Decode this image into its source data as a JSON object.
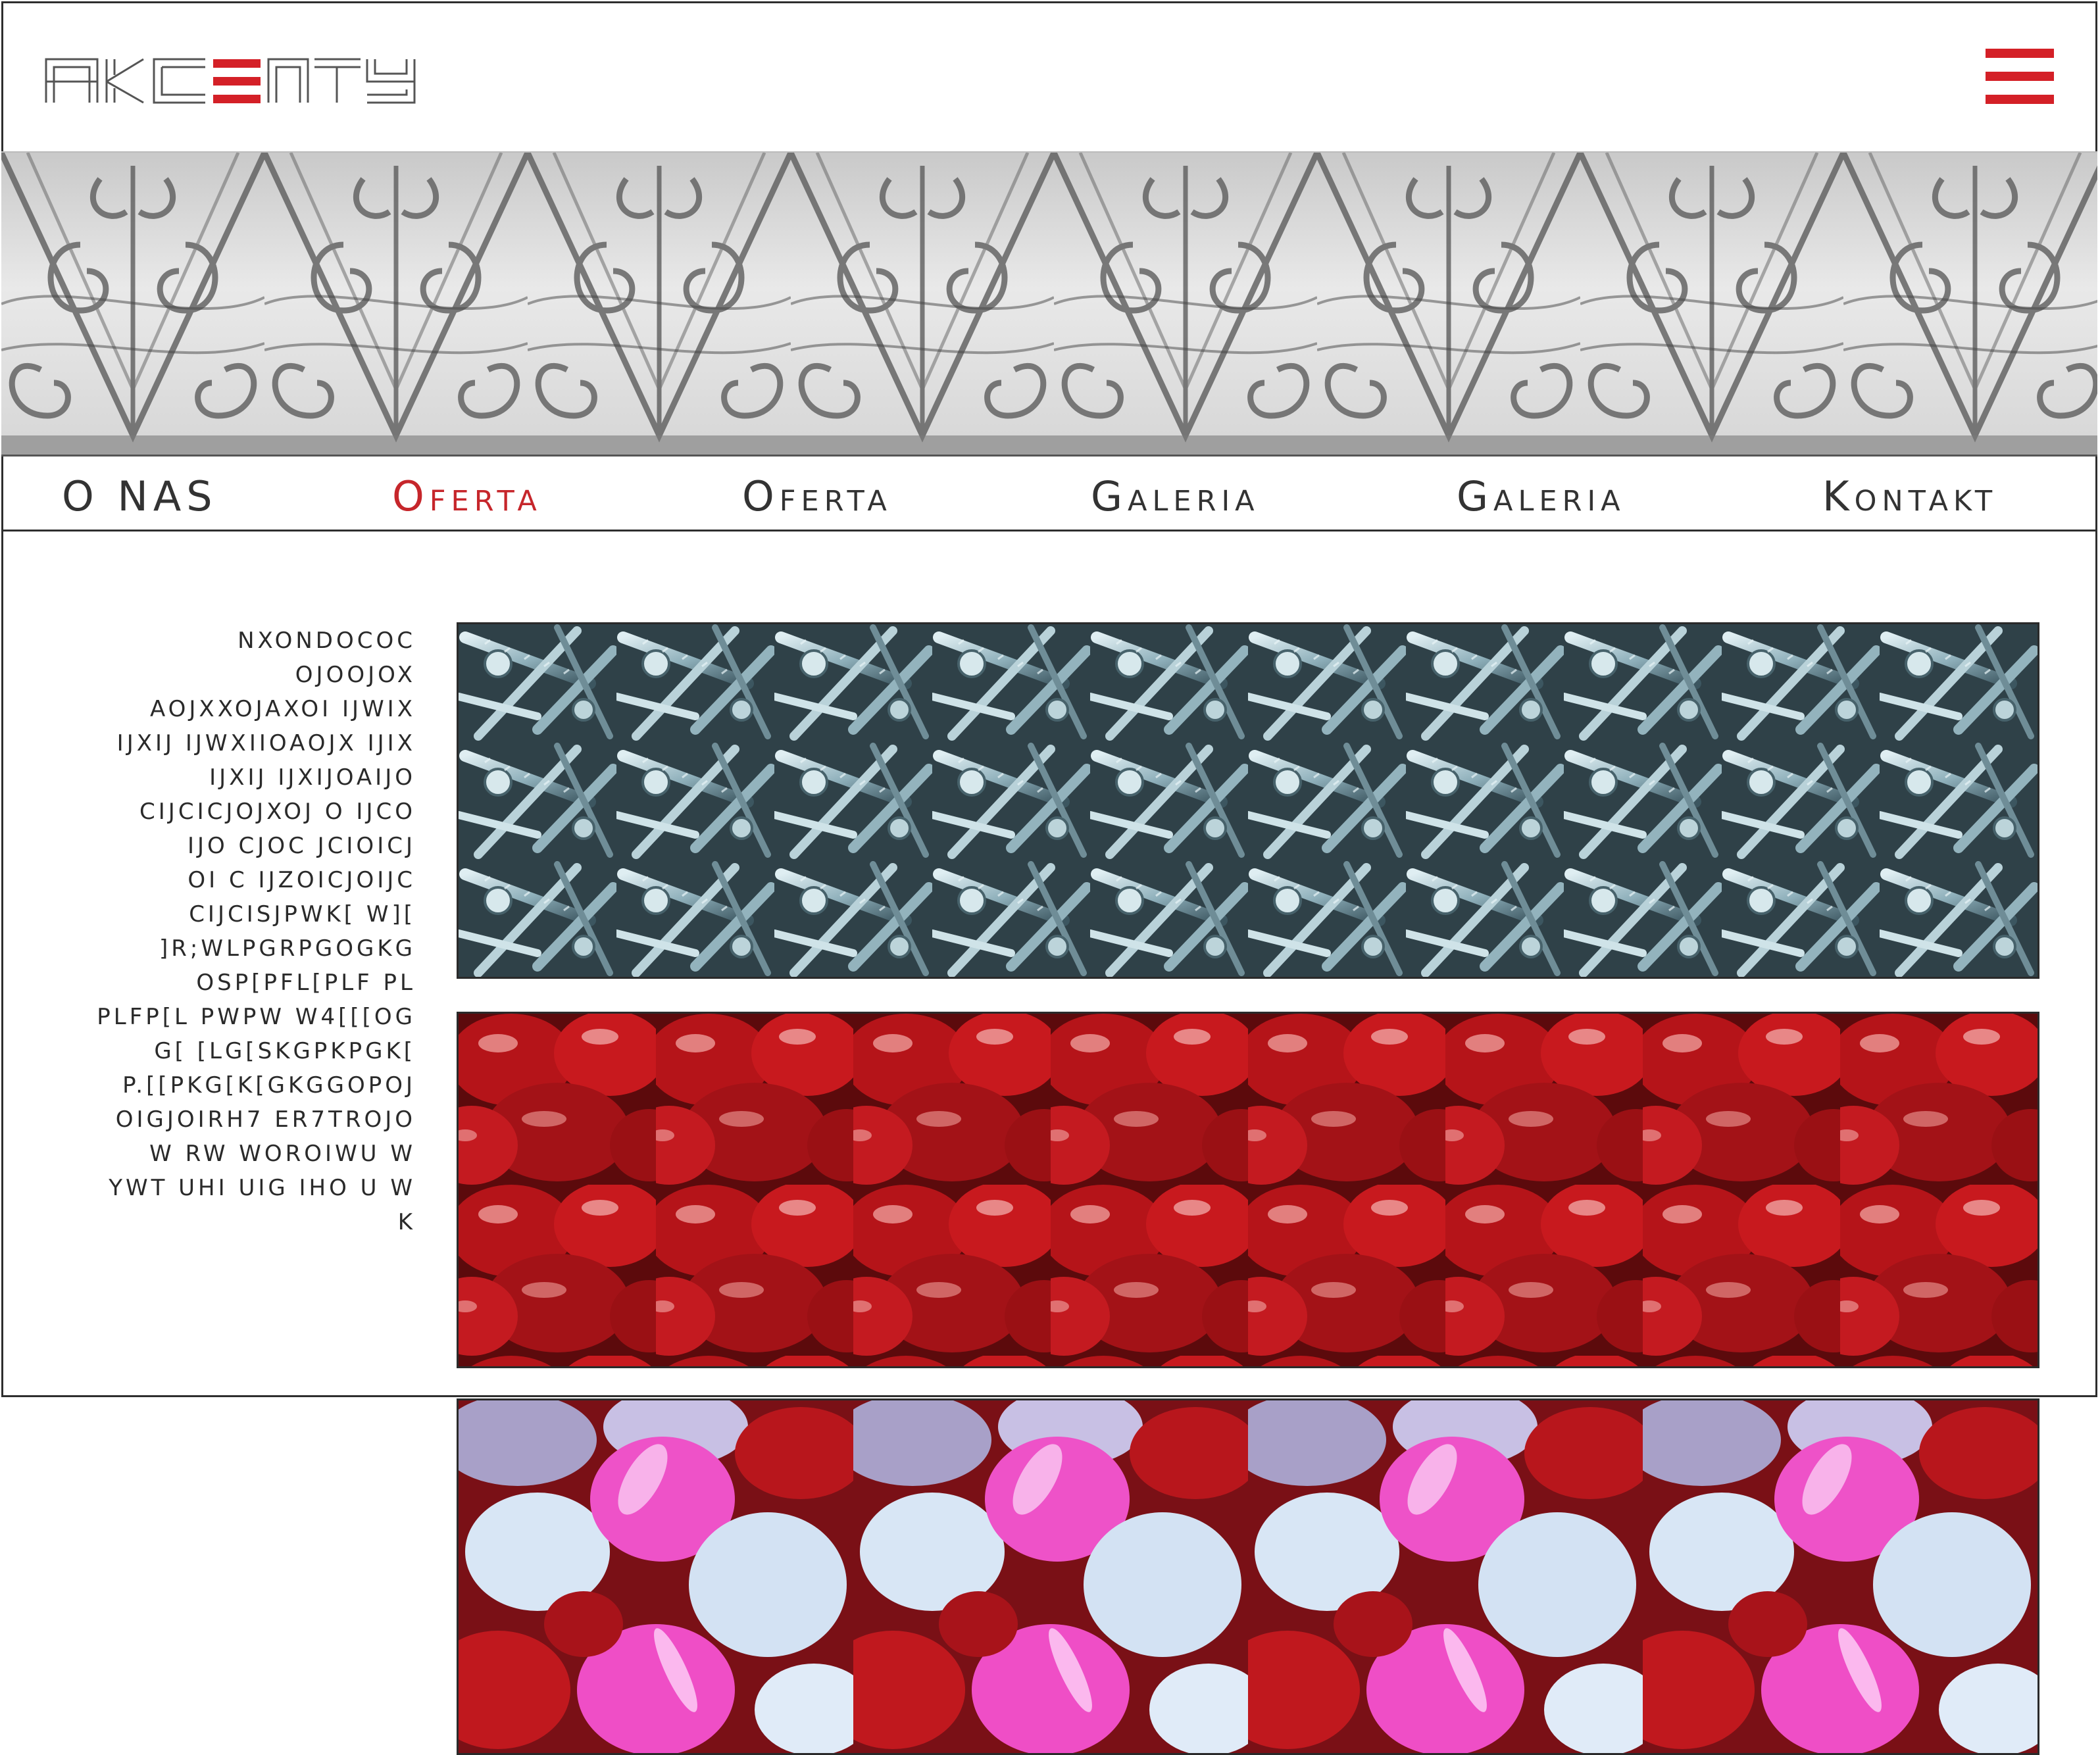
{
  "header": {
    "logo_text": "AKCENTY",
    "menu_icon": "hamburger-menu-icon"
  },
  "banner": {
    "image": "wrought-iron-fence-pattern"
  },
  "nav": {
    "items": [
      {
        "label": "O   NAS",
        "active": false
      },
      {
        "label": "Oferta",
        "active": true
      },
      {
        "label": "Oferta",
        "active": false
      },
      {
        "label": "Galeria",
        "active": false
      },
      {
        "label": "Galeria",
        "active": false
      },
      {
        "label": "Kontakt",
        "active": false
      }
    ]
  },
  "content": {
    "text_lines": [
      "nxondococ",
      "ojoojox",
      "aojxxojaxoi ijwix",
      "ijxij ijwxiioaojx ijix",
      "ijxij ijxijoaijo",
      "cijcicjojxoj o  ijco",
      "ijo cjoc   jcioicj",
      "oi c ijzoicjoijc",
      "cijcisjpwk[ w][",
      "]r;wlpgrpgogkg",
      "osp[pfl[plf pl",
      "plfp[l pwpw w4[[[og",
      "g[ [lg[skgpkpgk[",
      "p.[[pkg[k[gkggopoj",
      "oigjoirh7 er7trojo",
      "w rw  woroiwu w",
      "ywt  uhi uig iho u w",
      "k"
    ],
    "images": [
      {
        "name": "screws-photo",
        "accent": "#a9c2cc"
      },
      {
        "name": "red-hearts-photo",
        "accent": "#c0161c"
      },
      {
        "name": "pink-white-hearts-photo",
        "accent": "#ee52c8"
      }
    ]
  },
  "colors": {
    "accent_red": "#d42027",
    "border": "#2e2e2e",
    "text": "#333333"
  }
}
